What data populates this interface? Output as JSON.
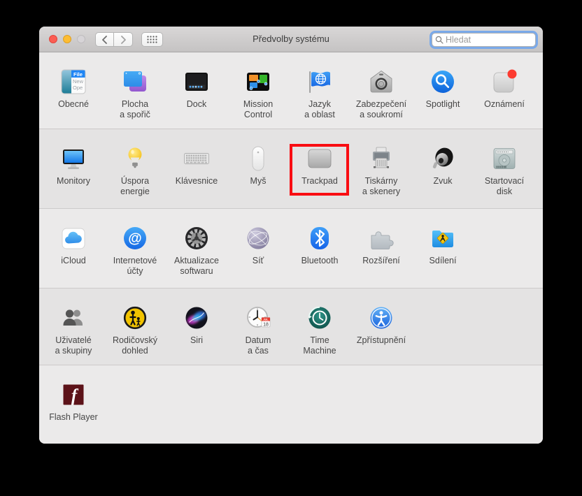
{
  "window": {
    "title": "Předvolby systému"
  },
  "titlebar": {
    "search_placeholder": "Hledat",
    "back_button": "chevron-left",
    "forward_button": "chevron-right",
    "show_all_button": "grid-icon"
  },
  "colors": {
    "highlight_box_red": "#f90d12",
    "traffic_red": "#fb5d53",
    "traffic_yellow": "#fdbd33",
    "traffic_disabled_gray": "#d7d4d7",
    "search_focus_ring": "#7aa9e9",
    "row_bg_light": "#ebeaea",
    "row_bg_dark": "#e4e3e3"
  },
  "icon_text": {
    "general_menu": "File",
    "general_item1": "New",
    "general_item2": "Ope",
    "calendar_month": "JUL",
    "calendar_day": "18"
  },
  "highlight": {
    "target": "Trackpad"
  },
  "grid": {
    "rows": [
      {
        "items": [
          {
            "label": "Obecné",
            "icon": "general-icon"
          },
          {
            "label": "Plocha\na spořič",
            "icon": "desktop-screensaver-icon"
          },
          {
            "label": "Dock",
            "icon": "dock-icon"
          },
          {
            "label": "Mission\nControl",
            "icon": "mission-control-icon"
          },
          {
            "label": "Jazyk\na oblast",
            "icon": "language-region-icon"
          },
          {
            "label": "Zabezpečení\na soukromí",
            "icon": "security-privacy-icon"
          },
          {
            "label": "Spotlight",
            "icon": "spotlight-icon"
          },
          {
            "label": "Oznámení",
            "icon": "notifications-icon"
          }
        ]
      },
      {
        "items": [
          {
            "label": "Monitory",
            "icon": "displays-icon"
          },
          {
            "label": "Úspora\nenergie",
            "icon": "energy-saver-icon"
          },
          {
            "label": "Klávesnice",
            "icon": "keyboard-icon"
          },
          {
            "label": "Myš",
            "icon": "mouse-icon"
          },
          {
            "label": "Trackpad",
            "icon": "trackpad-icon",
            "highlighted": true
          },
          {
            "label": "Tiskárny\na skenery",
            "icon": "printers-scanners-icon"
          },
          {
            "label": "Zvuk",
            "icon": "sound-icon"
          },
          {
            "label": "Startovací\ndisk",
            "icon": "startup-disk-icon"
          }
        ]
      },
      {
        "items": [
          {
            "label": "iCloud",
            "icon": "icloud-icon"
          },
          {
            "label": "Internetové\núčty",
            "icon": "internet-accounts-icon"
          },
          {
            "label": "Aktualizace\nsoftwaru",
            "icon": "software-update-icon"
          },
          {
            "label": "Síť",
            "icon": "network-icon"
          },
          {
            "label": "Bluetooth",
            "icon": "bluetooth-icon"
          },
          {
            "label": "Rozšíření",
            "icon": "extensions-icon"
          },
          {
            "label": "Sdílení",
            "icon": "sharing-icon"
          }
        ]
      },
      {
        "items": [
          {
            "label": "Uživatelé\na skupiny",
            "icon": "users-groups-icon"
          },
          {
            "label": "Rodičovský\ndohled",
            "icon": "parental-controls-icon"
          },
          {
            "label": "Siri",
            "icon": "siri-icon"
          },
          {
            "label": "Datum\na čas",
            "icon": "date-time-icon"
          },
          {
            "label": "Time\nMachine",
            "icon": "time-machine-icon"
          },
          {
            "label": "Zpřístupnění",
            "icon": "accessibility-icon"
          }
        ]
      },
      {
        "items": [
          {
            "label": "Flash Player",
            "icon": "flash-player-icon"
          }
        ]
      }
    ]
  }
}
